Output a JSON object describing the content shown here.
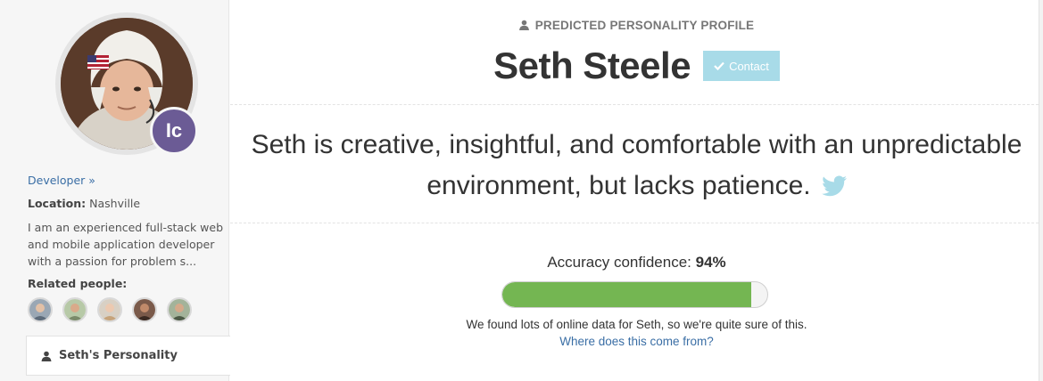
{
  "sidebar": {
    "badge": "Ic",
    "developer_link": "Developer »",
    "location_label": "Location:",
    "location_value": "Nashville",
    "bio": "I am an experienced full-stack web and mobile application developer with a passion for problem s...",
    "related_label": "Related people:",
    "related_count": 5,
    "nav_item": "Seth's Personality"
  },
  "main": {
    "kicker": "PREDICTED PERSONALITY PROFILE",
    "name": "Seth Steele",
    "contact_label": "Contact",
    "summary": "Seth is creative, insightful, and comfortable with an unpredictable environment, but lacks patience.",
    "accuracy_label": "Accuracy confidence:",
    "accuracy_value": "94%",
    "accuracy_fraction": 0.94,
    "found_text": "We found lots of online data for Seth, so we're quite sure of this.",
    "where_link": "Where does this come from?"
  },
  "colors": {
    "accent_link": "#3a6ea5",
    "badge_bg": "#6b5b95",
    "contact_bg": "#a8dbe8",
    "bar_fill": "#74b652",
    "twitter": "#a8dbe8"
  },
  "icons": [
    "user-icon",
    "check-icon",
    "twitter-icon"
  ]
}
